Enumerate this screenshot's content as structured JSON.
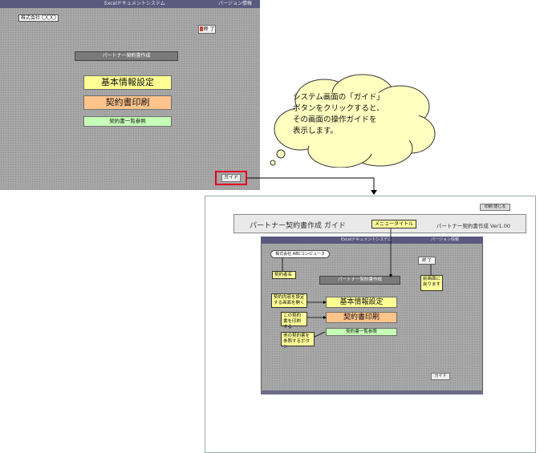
{
  "main_window": {
    "title": "Excelドキュメントシステム",
    "version": "バージョン情報",
    "company": "株式会社 〇〇〇",
    "exit_label": "終 了",
    "menu_title": "パートナー契約書作成",
    "buttons": {
      "basic_info": "基本情報設定",
      "contract_print": "契約書印刷",
      "contract_list": "契約書一覧参照"
    },
    "guide_button": "ガイド"
  },
  "callout": {
    "text": "システム画面の「ガイド」\nボタンをクリックすると、\nその画面の操作ガイドを\n表示します。"
  },
  "guide_screen": {
    "top_button": "印刷 閉じる",
    "header_title": "パートナー契約書作成 ガイド",
    "header_version": "パートナー契約書作成 Ver1.00",
    "menu_title_note": "メニュータイトル",
    "window_title": "Excelドキュメントシステム",
    "window_version": "バージョン情報",
    "company": "株式会社 ABCコンピュータ",
    "exit_label": "終 了",
    "menu_title": "パートナー契約書作成",
    "notes": {
      "company": "契約者名",
      "exit": "前画面に戻ります",
      "basic": "契約内容を設定する画面を開く",
      "print": "この契約書を印刷する",
      "list": "他の契約書を参照するボタン"
    },
    "buttons": {
      "basic_info": "基本情報設定",
      "contract_print": "契約書印刷",
      "contract_list": "契約書一覧参照"
    },
    "guide_button": "ガイド"
  },
  "colors": {
    "title_bar": "#5a5a7e",
    "basic_button": "#ffff93",
    "print_button": "#ffc48c",
    "list_button": "#c6ffb8",
    "highlight": "#e0001a",
    "callout_fill": "#ffffc0"
  }
}
